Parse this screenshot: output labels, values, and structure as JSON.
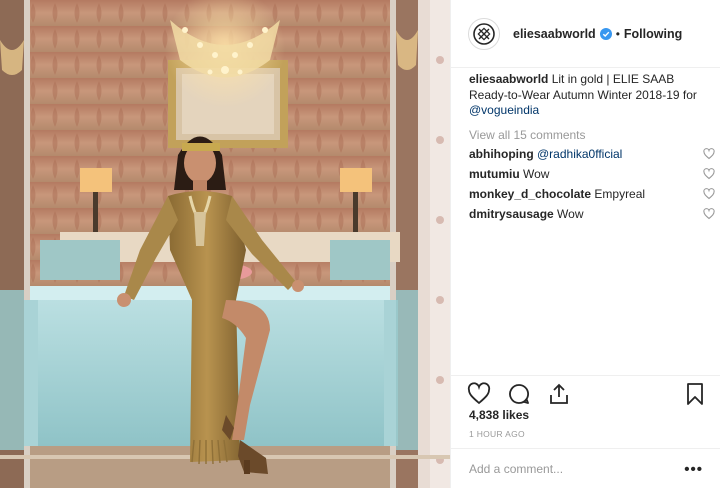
{
  "post": {
    "username": "eliesaabworld",
    "follow_status": "Following",
    "separator": "•",
    "caption": {
      "user": "eliesaabworld",
      "text": " Lit in gold | ELIE SAAB Ready-to-Wear Autumn Winter 2018-19 for ",
      "mention": "@vogueindia"
    },
    "view_all_comments": "View all 15 comments",
    "comments": [
      {
        "user": "abhihoping",
        "text": "@radhika0fficial",
        "is_mention": true
      },
      {
        "user": "mutumiu",
        "text": "Wow",
        "is_mention": false
      },
      {
        "user": "monkey_d_chocolate",
        "text": "Empyreal",
        "is_mention": false
      },
      {
        "user": "dmitrysausage",
        "text": "Wow",
        "is_mention": false
      }
    ],
    "likes": "4,838 likes",
    "timestamp": "1 HOUR AGO",
    "add_comment_placeholder": "Add a comment...",
    "more_options": "•••"
  },
  "icons": [
    "brand-logo-icon",
    "verified-badge-icon",
    "comment-heart-icon",
    "like-heart-icon",
    "comment-bubble-icon",
    "share-icon",
    "bookmark-icon"
  ],
  "colors": {
    "text": "#262626",
    "muted": "#999999",
    "link": "#003569",
    "verified": "#3897f0",
    "divider": "#efefef"
  }
}
